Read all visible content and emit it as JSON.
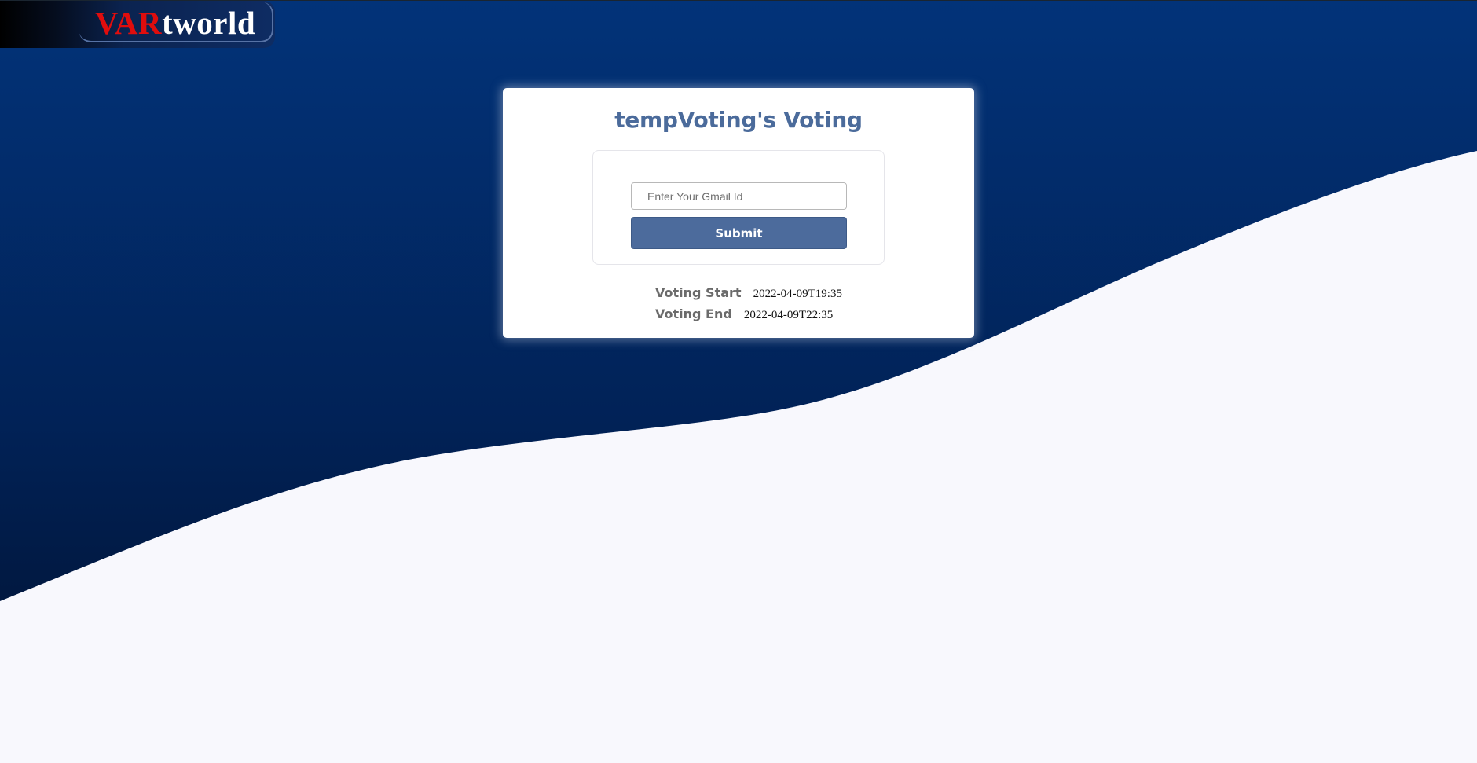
{
  "header": {
    "logo_red": "VAR",
    "logo_white": "tworld"
  },
  "voting": {
    "title": "tempVoting's Voting",
    "email_placeholder": "Enter Your Gmail Id",
    "email_value": "",
    "submit_label": "Submit",
    "start_label": "Voting Start",
    "start_value": "2022-04-09T19:35",
    "end_label": "Voting End",
    "end_value": "2022-04-09T22:35"
  },
  "colors": {
    "background_top": "#023379",
    "background_bottom": "#01102d",
    "wave_fill": "#f8f8fd",
    "accent": "#4c6b9c",
    "logo_red": "#e00d0d"
  }
}
